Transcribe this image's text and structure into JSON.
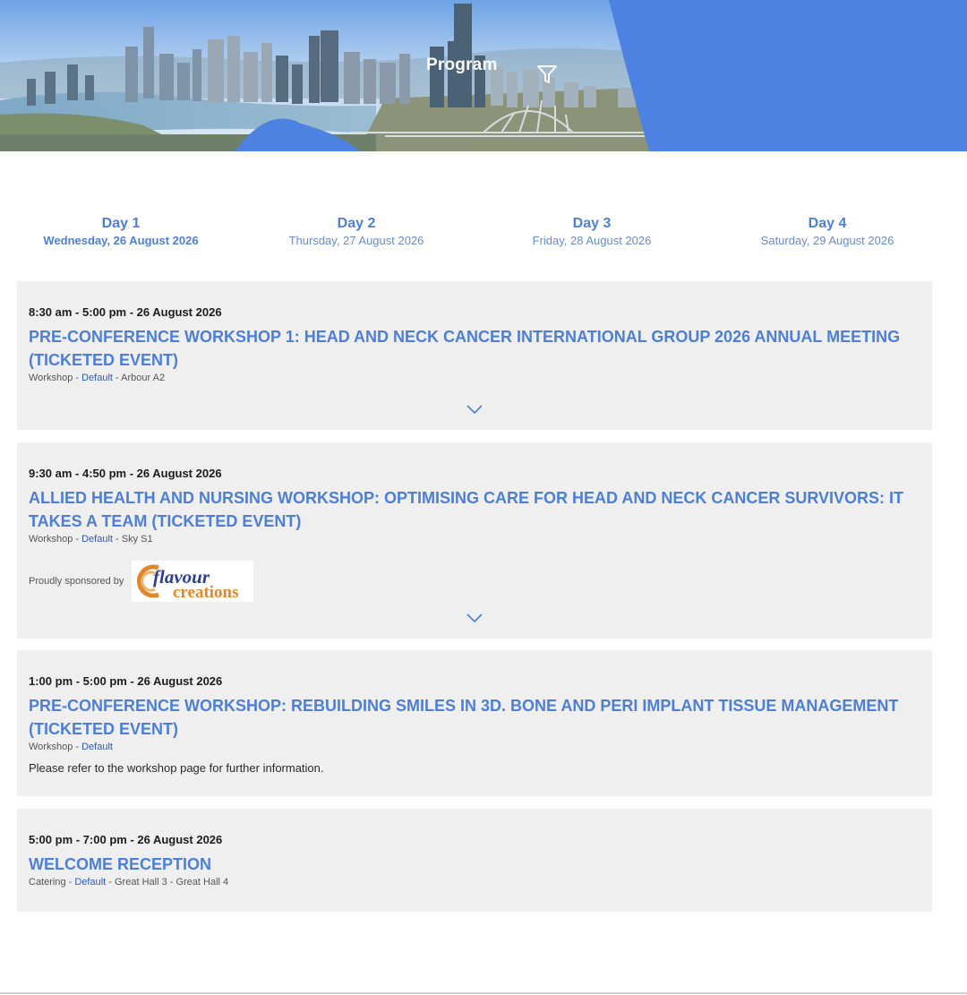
{
  "header": {
    "title": "Program",
    "filter_icon": "filter-icon",
    "colors": {
      "brand_blue": "#4d82e3",
      "sky": "#bfd8f0"
    }
  },
  "days": [
    {
      "label": "Day 1",
      "date": "Wednesday, 26 August 2026",
      "active": true
    },
    {
      "label": "Day 2",
      "date": "Thursday, 27 August 2026",
      "active": false
    },
    {
      "label": "Day 3",
      "date": "Friday, 28 August 2026",
      "active": false
    },
    {
      "label": "Day 4",
      "date": "Saturday, 29 August 2026",
      "active": false
    }
  ],
  "sessions": [
    {
      "time": "8:30 am - 5:00 pm - 26 August 2026",
      "title": "PRE-CONFERENCE WORKSHOP 1: HEAD AND NECK CANCER INTERNATIONAL GROUP 2026 ANNUAL MEETING (TICKETED EVENT)",
      "type": "Workshop",
      "stream": "Default",
      "location": "Arbour A2",
      "sep": " - "
    },
    {
      "time": "9:30 am - 4:50 pm - 26 August 2026",
      "title": "ALLIED HEALTH AND NURSING WORKSHOP: OPTIMISING CARE FOR HEAD AND NECK CANCER SURVIVORS: IT TAKES A TEAM (TICKETED EVENT)",
      "type": "Workshop",
      "stream": "Default",
      "location": "Sky S1",
      "sep": " - ",
      "sponsor_text": "Proudly sponsored by",
      "sponsor_logo_text_1": "flavour",
      "sponsor_logo_text_2": "creations"
    },
    {
      "time": "1:00 pm - 5:00 pm - 26 August 2026",
      "title": "PRE-CONFERENCE WORKSHOP: REBUILDING SMILES IN 3D. BONE AND PERI IMPLANT TISSUE MANAGEMENT (TICKETED EVENT)",
      "type": "Workshop",
      "stream": "Default",
      "sep": " - ",
      "note": "Please refer to the workshop page for further information."
    },
    {
      "time": "5:00 pm - 7:00 pm - 26 August 2026",
      "title": "WELCOME RECEPTION",
      "type": "Catering",
      "stream": "Default",
      "location": "Great Hall 3 - Great Hall 4",
      "sep": " - "
    }
  ]
}
